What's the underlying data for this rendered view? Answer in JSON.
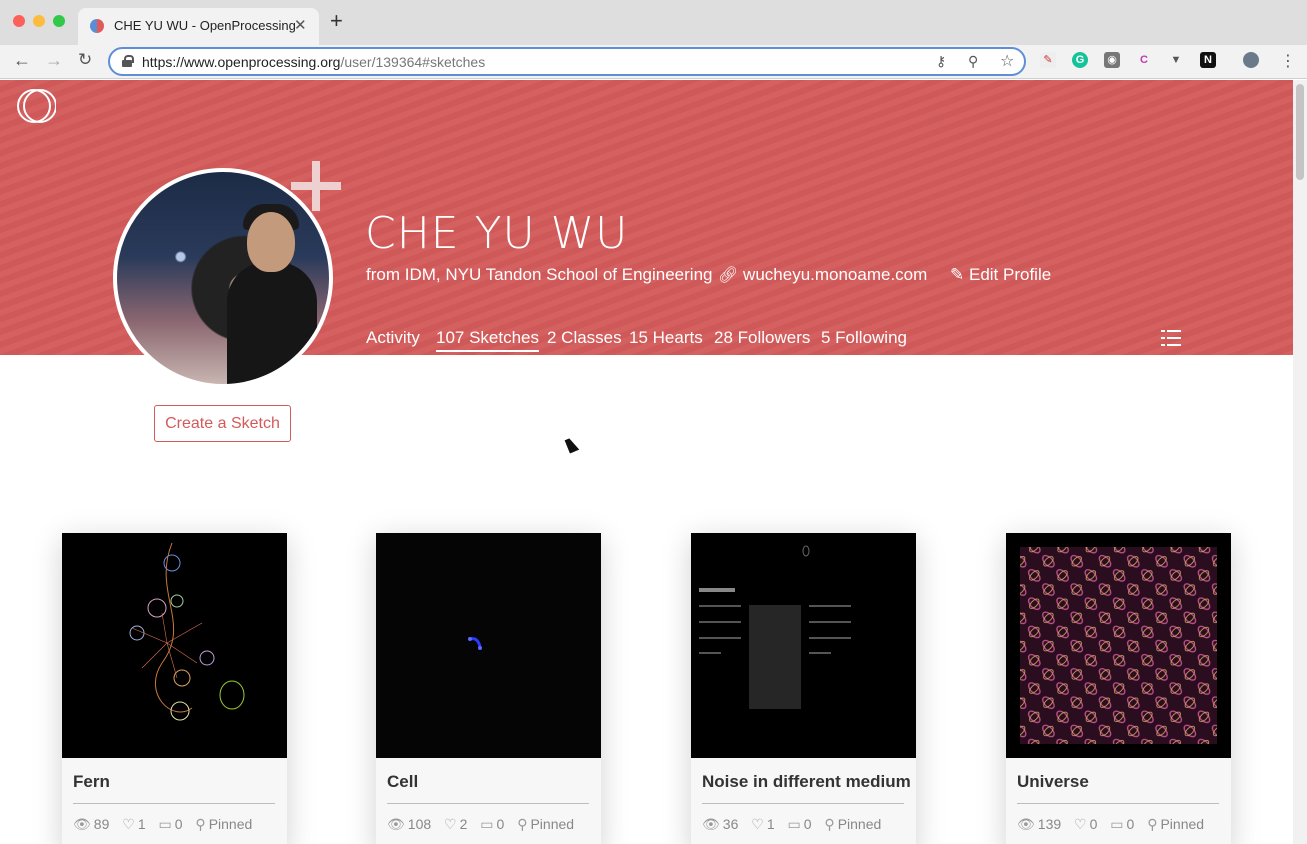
{
  "browser": {
    "tab_title": "CHE YU WU - OpenProcessing",
    "tab_close": "✕",
    "new_tab": "+",
    "url_host": "https://www.openprocessing.org",
    "url_path": "/user/139364#sketches"
  },
  "profile": {
    "name": "CHE YU WU",
    "affiliation": "from IDM, NYU Tandon School of Engineering",
    "website": "wucheyu.monoame.com",
    "edit_label": "Edit Profile",
    "create_button": "Create a Sketch"
  },
  "nav": [
    {
      "label": "Activity"
    },
    {
      "label": "107 Sketches"
    },
    {
      "label": "2 Classes"
    },
    {
      "label": "15 Hearts"
    },
    {
      "label": "28 Followers"
    },
    {
      "label": "5 Following"
    }
  ],
  "sketches": [
    {
      "title": "Fern",
      "views": "89",
      "hearts": "1",
      "comments": "0",
      "pinned": "Pinned"
    },
    {
      "title": "Cell",
      "views": "108",
      "hearts": "2",
      "comments": "0",
      "pinned": "Pinned"
    },
    {
      "title": "Noise in different medium",
      "views": "36",
      "hearts": "1",
      "comments": "0",
      "pinned": "Pinned"
    },
    {
      "title": "Universe",
      "views": "139",
      "hearts": "0",
      "comments": "0",
      "pinned": "Pinned"
    }
  ],
  "colors": {
    "accent": "#d35a5a"
  }
}
